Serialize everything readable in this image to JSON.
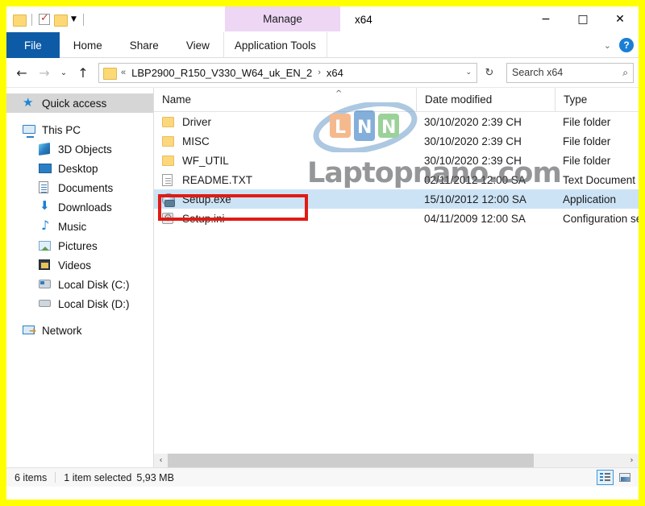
{
  "window": {
    "title": "x64",
    "quick_access_toolbar": [
      {
        "name": "folder-icon",
        "label": ""
      },
      {
        "name": "properties-icon",
        "label": ""
      },
      {
        "name": "new-folder-icon",
        "label": ""
      },
      {
        "name": "customize-dropdown-icon",
        "label": "▼"
      }
    ],
    "contextual_tab": "Manage",
    "controls": {
      "minimize": "−",
      "maximize": "□",
      "close": "✕"
    }
  },
  "ribbon": {
    "tabs": [
      {
        "label": "File",
        "active": true
      },
      {
        "label": "Home",
        "active": false
      },
      {
        "label": "Share",
        "active": false
      },
      {
        "label": "View",
        "active": false
      },
      {
        "label": "Application Tools",
        "active": false
      }
    ],
    "collapse_icon": "⌄",
    "help_label": "?"
  },
  "addressbar": {
    "back_icon": "←",
    "forward_icon": "→",
    "recent_icon": "⌄",
    "up_icon": "↑",
    "path_prefix": "«",
    "path_segments": [
      "LBP2900_R150_V330_W64_uk_EN_2",
      "x64"
    ],
    "path_separator": "›",
    "dropdown_icon": "⌄",
    "refresh_icon": "↻",
    "search_placeholder": "Search x64",
    "search_value": "",
    "search_icon": "⌕"
  },
  "navpane": {
    "items": [
      {
        "label": "Quick access",
        "icon": "star-icon",
        "level": 0,
        "selected": true
      },
      {
        "label": "This PC",
        "icon": "computer-icon",
        "level": 0,
        "selected": false
      },
      {
        "label": "3D Objects",
        "icon": "3d-objects-icon",
        "level": 1,
        "selected": false
      },
      {
        "label": "Desktop",
        "icon": "desktop-icon",
        "level": 1,
        "selected": false
      },
      {
        "label": "Documents",
        "icon": "documents-icon",
        "level": 1,
        "selected": false
      },
      {
        "label": "Downloads",
        "icon": "downloads-icon",
        "level": 1,
        "selected": false
      },
      {
        "label": "Music",
        "icon": "music-icon",
        "level": 1,
        "selected": false
      },
      {
        "label": "Pictures",
        "icon": "pictures-icon",
        "level": 1,
        "selected": false
      },
      {
        "label": "Videos",
        "icon": "videos-icon",
        "level": 1,
        "selected": false
      },
      {
        "label": "Local Disk (C:)",
        "icon": "disk-c-icon",
        "level": 1,
        "selected": false
      },
      {
        "label": "Local Disk (D:)",
        "icon": "disk-d-icon",
        "level": 1,
        "selected": false
      },
      {
        "label": "Network",
        "icon": "network-icon",
        "level": 0,
        "selected": false
      }
    ]
  },
  "filelist": {
    "columns": [
      {
        "label": "Name",
        "sort": "asc",
        "sort_icon": "^"
      },
      {
        "label": "Date modified",
        "sort": null,
        "sort_icon": ""
      },
      {
        "label": "Type",
        "sort": null,
        "sort_icon": ""
      }
    ],
    "rows": [
      {
        "name": "Driver",
        "date": "30/10/2020 2:39 CH",
        "type": "File folder",
        "icon": "folder-icon",
        "selected": false
      },
      {
        "name": "MISC",
        "date": "30/10/2020 2:39 CH",
        "type": "File folder",
        "icon": "folder-icon",
        "selected": false
      },
      {
        "name": "WF_UTIL",
        "date": "30/10/2020 2:39 CH",
        "type": "File folder",
        "icon": "folder-icon",
        "selected": false
      },
      {
        "name": "README.TXT",
        "date": "02/11/2012 12:00 SA",
        "type": "Text Document",
        "icon": "text-file-icon",
        "selected": false
      },
      {
        "name": "Setup.exe",
        "date": "15/10/2012 12:00 SA",
        "type": "Application",
        "icon": "application-icon",
        "selected": true
      },
      {
        "name": "Setup.ini",
        "date": "04/11/2009 12:00 SA",
        "type": "Configuration set",
        "icon": "config-file-icon",
        "selected": false
      }
    ],
    "scroll_left_icon": "‹",
    "scroll_right_icon": "›"
  },
  "watermark": {
    "logo_letters": [
      "L",
      "N",
      "N"
    ],
    "text": "Laptopnano.com"
  },
  "statusbar": {
    "item_count": "6 items",
    "selection": "1 item selected",
    "size": "5,93 MB",
    "views": [
      {
        "name": "details-view-button",
        "active": true
      },
      {
        "name": "large-icons-view-button",
        "active": false
      }
    ]
  },
  "colors": {
    "border_highlight": "#ffff00",
    "selection_box": "#e01b15",
    "row_selected": "#cce3f5",
    "file_tab": "#0d5ba6",
    "contextual_tab": "#eed6f5",
    "help_blue": "#1a7fd4"
  }
}
